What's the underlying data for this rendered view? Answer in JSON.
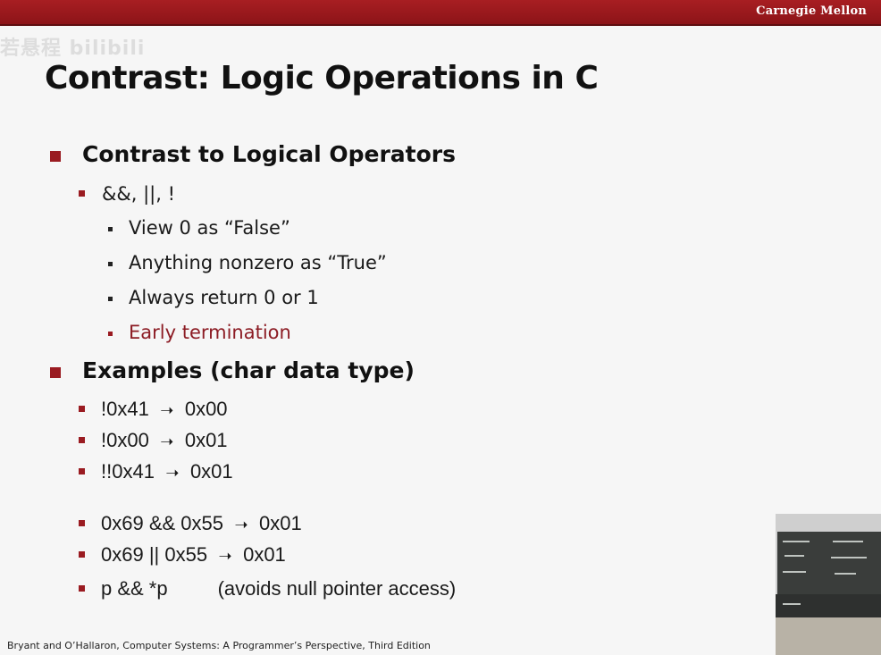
{
  "header": {
    "brand": "Carnegie Mellon",
    "watermark": "若悬程 bilibili"
  },
  "slide": {
    "title": "Contrast: Logic Operations in C",
    "section_1": {
      "heading": "Contrast to Logical Operators",
      "operators": "&&, ||, !",
      "points": [
        "View 0 as “False”",
        "Anything nonzero as “True”",
        "Always return 0 or 1",
        "Early termination"
      ]
    },
    "section_2": {
      "heading": "Examples (char data type)",
      "examples": [
        {
          "expr": "!0x41",
          "result": "0x00"
        },
        {
          "expr": "!0x00",
          "result": "0x01"
        },
        {
          "expr": "!!0x41",
          "result": "0x01"
        },
        {
          "expr": "0x69 && 0x55",
          "result": "0x01"
        },
        {
          "expr": "0x69 || 0x55",
          "result": "0x01"
        },
        {
          "expr": "p && *p",
          "note": "(avoids null pointer access)"
        }
      ],
      "arrow": "➝"
    }
  },
  "footer": {
    "citation": "Bryant and O’Hallaron, Computer Systems: A Programmer’s Perspective, Third Edition"
  },
  "colors": {
    "brand_bar": "#9a1b21",
    "bullet": "#9a1b21",
    "emphasis_text": "#8c1c24"
  },
  "icons": {
    "bullet": "square-bullet-icon",
    "arrow": "right-arrow-icon"
  }
}
